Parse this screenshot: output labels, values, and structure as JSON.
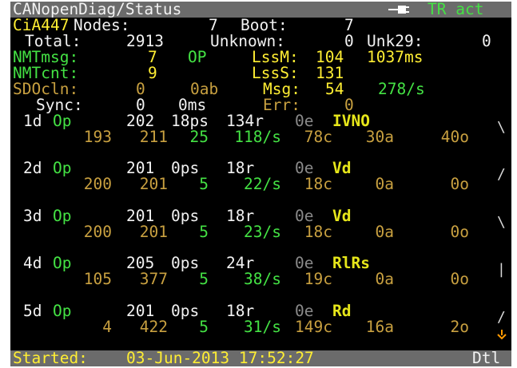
{
  "title_bar": {
    "title": "CANopenDiag/Status",
    "tr_status": "TR act"
  },
  "summary": {
    "cia_label": "CiA447",
    "nodes_label": "Nodes:",
    "nodes_value": "7",
    "boot_label": "Boot:",
    "boot_value": "7",
    "total_label": "Total:",
    "total_value": "2913",
    "unknown_label": "Unknown:",
    "unknown_value": "0",
    "unk29_label": "Unk29:",
    "unk29_value": "0",
    "nmtmsg_label": "NMTmsg:",
    "nmtmsg_value": "7",
    "nmtmsg_state": "OP",
    "lssm_label": "LssM:",
    "lssm_value": "104",
    "lssm_time": "1037ms",
    "nmtcnt_label": "NMTcnt:",
    "nmtcnt_value": "9",
    "lsss_label": "LssS:",
    "lsss_value": "131",
    "sdocln_label": "SDOcln:",
    "sdocln_value": "0",
    "sdocln_ab": "0ab",
    "msg_label": "Msg:",
    "msg_value": "54",
    "msg_rate": "278/s",
    "sync_label": "Sync:",
    "sync_value": "0",
    "sync_ms": "0ms",
    "err_label": "Err:",
    "err_value": "0"
  },
  "nodes": [
    {
      "id": "1d",
      "state": "Op",
      "num": "202",
      "ps": "18ps",
      "r": "134r",
      "e": "0e",
      "name": "IVNO",
      "l2a": "193",
      "l2b": "211",
      "l2c": "25",
      "rate": "118/s",
      "c": "78c",
      "a": "30a",
      "o": "40o",
      "mark": "\\"
    },
    {
      "id": "2d",
      "state": "Op",
      "num": "201",
      "ps": "0ps",
      "r": "18r",
      "e": "0e",
      "name": "Vd",
      "l2a": "200",
      "l2b": "201",
      "l2c": "5",
      "rate": "22/s",
      "c": "18c",
      "a": "0a",
      "o": "0o",
      "mark": "/"
    },
    {
      "id": "3d",
      "state": "Op",
      "num": "201",
      "ps": "0ps",
      "r": "18r",
      "e": "0e",
      "name": "Vd",
      "l2a": "200",
      "l2b": "201",
      "l2c": "5",
      "rate": "23/s",
      "c": "18c",
      "a": "0a",
      "o": "0o",
      "mark": "\\"
    },
    {
      "id": "4d",
      "state": "Op",
      "num": "205",
      "ps": "0ps",
      "r": "24r",
      "e": "0e",
      "name": "RlRs",
      "l2a": "105",
      "l2b": "377",
      "l2c": "5",
      "rate": "38/s",
      "c": "19c",
      "a": "0a",
      "o": "0o",
      "mark": "|"
    },
    {
      "id": "5d",
      "state": "Op",
      "num": "201",
      "ps": "0ps",
      "r": "18r",
      "e": "0e",
      "name": "Rd",
      "l2a": "4",
      "l2b": "422",
      "l2c": "5",
      "rate": "31/s",
      "c": "149c",
      "a": "16a",
      "o": "2o",
      "mark": "/"
    }
  ],
  "status_bar": {
    "started_label": "Started:",
    "started_value": "03-Jun-2013 17:52:27",
    "dtl_label": "Dtl"
  },
  "icons": {
    "plug": "plug-icon",
    "scroll": "down-arrow-icon"
  }
}
